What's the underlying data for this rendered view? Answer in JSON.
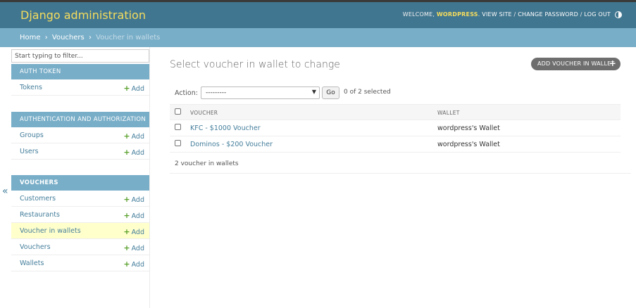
{
  "header": {
    "site_name": "Django administration",
    "welcome": "WELCOME,",
    "username": "WORDPRESS",
    "view_site": "VIEW SITE",
    "change_password": "CHANGE PASSWORD",
    "log_out": "LOG OUT",
    "separator": "/",
    "icon": "theme-toggle-icon"
  },
  "breadcrumbs": {
    "home": "Home",
    "app": "Vouchers",
    "current": "Voucher in wallets",
    "separator": "›"
  },
  "sidebar": {
    "filter_placeholder": "Start typing to filter...",
    "toggle_label": "«",
    "add_label": "Add",
    "plus": "+",
    "modules": [
      {
        "caption": "AUTH TOKEN",
        "models": [
          "Tokens"
        ]
      },
      {
        "caption": "AUTHENTICATION AND AUTHORIZATION",
        "models": [
          "Groups",
          "Users"
        ]
      },
      {
        "caption": "VOUCHERS",
        "models": [
          "Customers",
          "Restaurants",
          "Voucher in wallets",
          "Vouchers",
          "Wallets"
        ]
      }
    ],
    "selected_model": "Voucher in wallets"
  },
  "content": {
    "title": "Select voucher in wallet to change",
    "add_button": "ADD VOUCHER IN WALLET",
    "add_button_plus": "+",
    "action_label": "Action:",
    "action_selected": "---------",
    "go_button": "Go",
    "selection_count": "0 of 2 selected",
    "columns": [
      "VOUCHER",
      "WALLET"
    ],
    "rows": [
      {
        "voucher": "KFC - $1000 Voucher",
        "wallet": "wordpress's Wallet"
      },
      {
        "voucher": "Dominos - $200 Voucher",
        "wallet": "wordpress's Wallet"
      }
    ],
    "paginator": "2 voucher in wallets"
  },
  "colors": {
    "header_bg": "#417690",
    "breadcrumb_bg": "#79aec8",
    "accent_yellow": "#f5dd5d",
    "link": "#447e9b",
    "add_green": "#5aa02c",
    "selected_row": "#ffffcc"
  }
}
